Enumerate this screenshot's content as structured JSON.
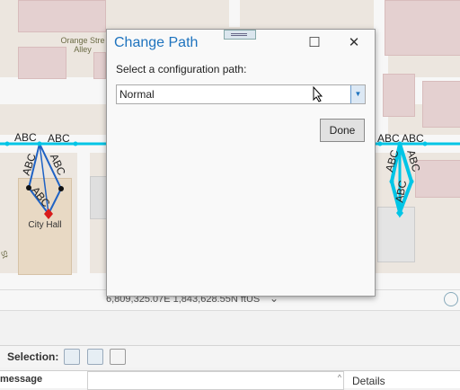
{
  "map": {
    "street_label": "Orange Street Alley",
    "street_label_line1": "Orange Stre",
    "street_label_line2": "Alley",
    "label_abc": "ABC",
    "poi_label": "City Hall",
    "side_street": "St",
    "coordinates": "6,809,325.07E 1,843,628.55N ftUS"
  },
  "dialog": {
    "title": "Change Path",
    "prompt": "Select a configuration path:",
    "selected_value": "Normal",
    "done_label": "Done",
    "maximize_icon": "maximize-icon",
    "close_icon": "close-icon"
  },
  "toolbar": {
    "selection_label": "Selection:"
  },
  "grid": {
    "message_header": "message",
    "details_label": "Details"
  },
  "colors": {
    "feature": "#00c5e6",
    "accent": "#1e73be",
    "vertex": "#111111",
    "pin": "#d81b1b"
  }
}
